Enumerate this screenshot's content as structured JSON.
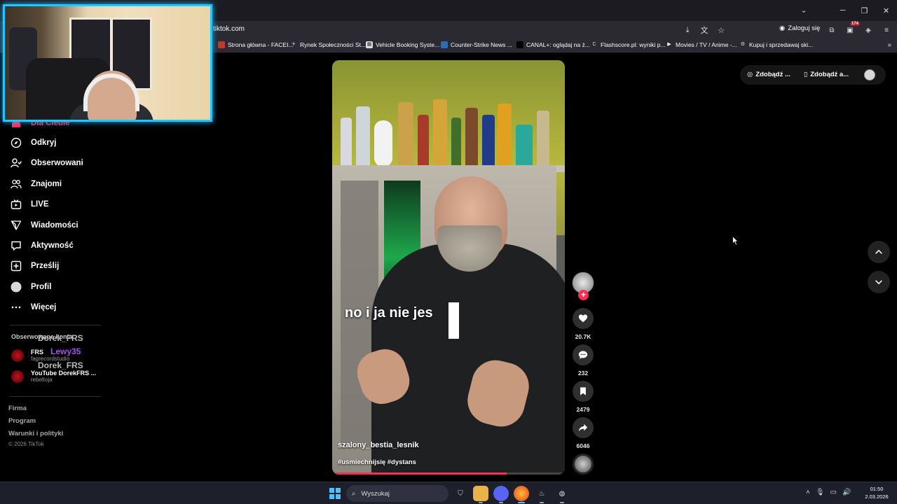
{
  "browser": {
    "url": "tiktok.com",
    "login_label": "Zaloguj się",
    "ext_badge": "174",
    "bookmarks": [
      "Strona główna - FACEI...",
      "Rynek Społeczności St...",
      "Vehicle Booking Syste...",
      "Counter-Strike News ...",
      "CANAL+: oglądaj na ż...",
      "Flashscore.pl: wyniki p...",
      "Movies / TV / Anime -...",
      "Kupuj i sprzedawaj ski..."
    ]
  },
  "sidebar": {
    "active_item": "Dla Ciebie",
    "items": [
      {
        "label": "Odkryj",
        "icon": "compass-icon"
      },
      {
        "label": "Obserwowani",
        "icon": "user-follow-icon"
      },
      {
        "label": "Znajomi",
        "icon": "friends-icon"
      },
      {
        "label": "LIVE",
        "icon": "live-tv-icon"
      },
      {
        "label": "Wiadomości",
        "icon": "send-icon"
      },
      {
        "label": "Aktywność",
        "icon": "activity-icon"
      },
      {
        "label": "Prześlij",
        "icon": "plus-square-icon"
      },
      {
        "label": "Profil",
        "icon": "profile-avatar-icon"
      },
      {
        "label": "Więcej",
        "icon": "more-dots-icon"
      }
    ],
    "following_heading": "Obserwowane konta",
    "following": [
      {
        "name": "FRS",
        "handle": "fagrecordstudio"
      },
      {
        "name": "YouTube DorekFRS ...",
        "handle": "rebeltoja"
      }
    ],
    "overlay_names": [
      "Dorek_FRS",
      "Lewy35",
      "Dorek_FRS"
    ],
    "footer_links": [
      "Firma",
      "Program",
      "Warunki i polityki"
    ],
    "copyright": "© 2026 TikTok"
  },
  "video": {
    "caption": "no i ja nie jes",
    "author": "szalony_bestia_lesnik",
    "hashtags": "#usmiechnijsię #dystans",
    "progress": 0.75
  },
  "actions": {
    "likes": "20.7K",
    "comments": "232",
    "saves": "2479",
    "shares": "6046"
  },
  "top_right": {
    "pill_coins": "Zdobądź ...",
    "pill_app": "Zdobądź a..."
  },
  "taskbar": {
    "search_placeholder": "Wyszukaj",
    "time": "01:50",
    "date": "2.03.2026"
  }
}
